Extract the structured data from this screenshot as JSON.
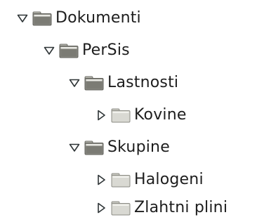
{
  "tree": {
    "root": {
      "label": "Dokumenti",
      "expanded": true,
      "icon": "folder-icon",
      "child": {
        "label": "PerSis",
        "expanded": true,
        "icon": "folder-icon",
        "children": [
          {
            "label": "Lastnosti",
            "expanded": true,
            "icon": "folder-icon",
            "children": [
              {
                "label": "Kovine",
                "expanded": false,
                "icon": "folder-open-icon"
              }
            ]
          },
          {
            "label": "Skupine",
            "expanded": true,
            "icon": "folder-icon",
            "children": [
              {
                "label": "Halogeni",
                "expanded": false,
                "icon": "folder-open-icon"
              },
              {
                "label": "Zlahtni plini",
                "expanded": false,
                "icon": "folder-open-icon"
              }
            ]
          }
        ]
      }
    }
  },
  "colors": {
    "expander": "#2e3436",
    "folder_dark_body": "#8d8d86",
    "folder_dark_tab": "#b8b8b0",
    "folder_light_body": "#d6d6cf",
    "folder_light_tab": "#b9b9b2",
    "text": "#1d1d1d"
  }
}
